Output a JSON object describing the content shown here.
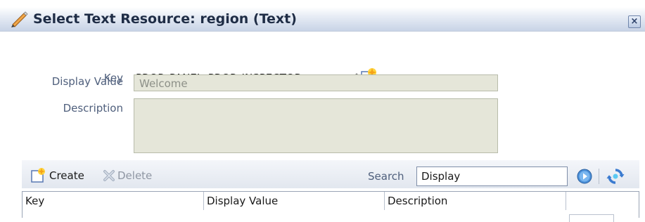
{
  "dialog": {
    "title": "Select Text Resource: region (Text)",
    "close_icon": "close-icon"
  },
  "form": {
    "key_label": "Key",
    "key_value": "PROP_PANEL_PROP_INSPECTOR",
    "display_value_label": "Display Value",
    "display_value": "Welcome",
    "description_label": "Description",
    "description_value": ""
  },
  "toolbar": {
    "create_label": "Create",
    "delete_label": "Delete",
    "search_label": "Search",
    "search_value": "Display"
  },
  "table": {
    "columns": [
      "Key",
      "Display Value",
      "Description"
    ]
  },
  "colors": {
    "title_bar": "#c8d3e6",
    "readonly_field": "#e5e6d9",
    "label_text": "#4f5f7c",
    "accent_blue": "#4a8fd8"
  }
}
